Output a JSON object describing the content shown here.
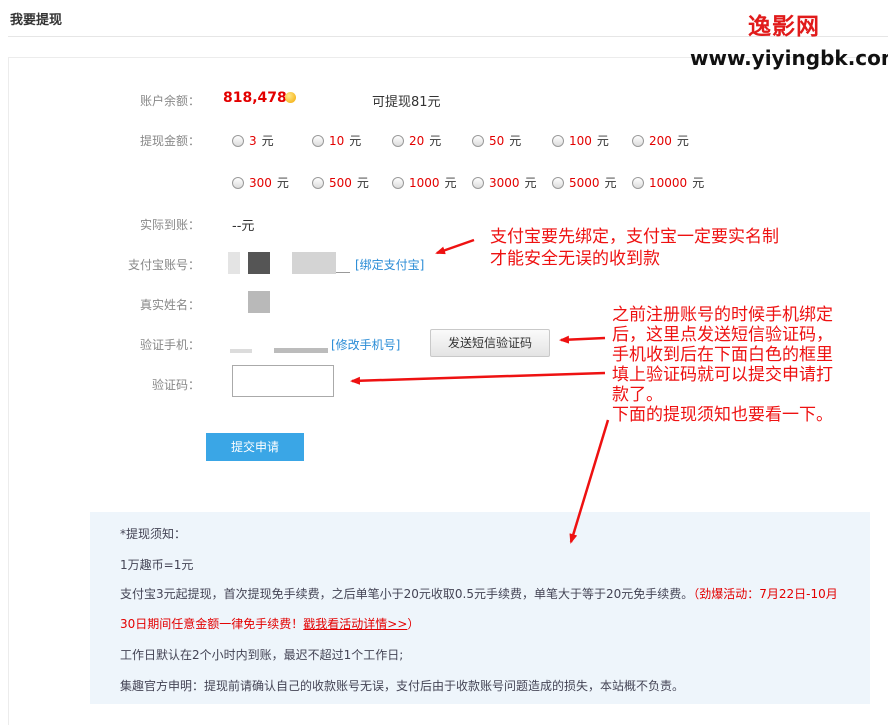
{
  "page": {
    "title": "我要提现"
  },
  "watermark": {
    "name": "逸影网",
    "url": "www.yiyingbk.com"
  },
  "labels": {
    "balance": "账户余额：",
    "amount": "提现金额：",
    "actual": "实际到账：",
    "alipay": "支付宝账号：",
    "realname": "真实姓名：",
    "phone": "验证手机：",
    "code": "验证码："
  },
  "balance": {
    "value": "818,478",
    "withdrawable": "可提现81元"
  },
  "amount_options": [
    {
      "num": "3",
      "unit": "元"
    },
    {
      "num": "10",
      "unit": "元"
    },
    {
      "num": "20",
      "unit": "元"
    },
    {
      "num": "50",
      "unit": "元"
    },
    {
      "num": "100",
      "unit": "元"
    },
    {
      "num": "200",
      "unit": "元"
    },
    {
      "num": "300",
      "unit": "元"
    },
    {
      "num": "500",
      "unit": "元"
    },
    {
      "num": "1000",
      "unit": "元"
    },
    {
      "num": "3000",
      "unit": "元"
    },
    {
      "num": "5000",
      "unit": "元"
    },
    {
      "num": "10000",
      "unit": "元"
    }
  ],
  "actual_value": "--元",
  "links": {
    "bind_alipay": "[绑定支付宝]",
    "change_phone": "[修改手机号]"
  },
  "buttons": {
    "send_sms": "发送短信验证码",
    "submit": "提交申请"
  },
  "code_input": {
    "value": ""
  },
  "notice": {
    "heading": "*提现须知：",
    "rate": "1万趣币=1元",
    "fee_text": "支付宝3元起提现，首次提现免手续费，之后单笔小于20元收取0.5元手续费，单笔大于等于20元免手续费。",
    "promo_start": "（劲爆活动：7月22日-10月",
    "promo_cont": "30日期间任意金额一律免手续费！",
    "promo_link": "戳我看活动详情>>",
    "promo_end": "）",
    "workday": "工作日默认在2个小时内到账，最迟不超过1个工作日;",
    "disclaimer": "集趣官方申明：提现前请确认自己的收款账号无误，支付后由于收款账号问题造成的损失，本站概不负责。"
  },
  "annotations": {
    "a1_line1": "支付宝要先绑定，支付宝一定要实名制",
    "a1_line2": "才能安全无误的收到款",
    "a2_line1": "之前注册账号的时候手机绑定",
    "a2_line2": "后，这里点发送短信验证码，",
    "a2_line3": "手机收到后在下面白色的框里",
    "a2_line4": "填上验证码就可以提交申请打",
    "a2_line5": "款了。",
    "a2_line6": "下面的提现须知也要看一下。"
  },
  "colors": {
    "accent_red": "#e30000",
    "link_blue": "#2a8cd6",
    "submit_blue": "#3aa6e6",
    "notice_bg": "#eef5fb",
    "annotation_red": "#ee1111"
  },
  "icons": {
    "coin": "gold-coin-icon"
  }
}
